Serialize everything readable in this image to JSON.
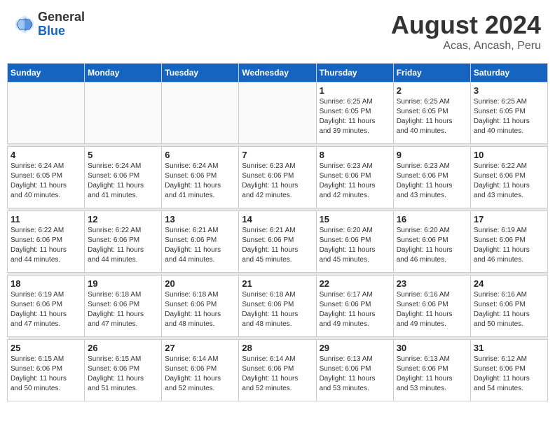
{
  "header": {
    "logo_general": "General",
    "logo_blue": "Blue",
    "month_year": "August 2024",
    "location": "Acas, Ancash, Peru"
  },
  "days_of_week": [
    "Sunday",
    "Monday",
    "Tuesday",
    "Wednesday",
    "Thursday",
    "Friday",
    "Saturday"
  ],
  "weeks": [
    [
      {
        "day": "",
        "info": ""
      },
      {
        "day": "",
        "info": ""
      },
      {
        "day": "",
        "info": ""
      },
      {
        "day": "",
        "info": ""
      },
      {
        "day": "1",
        "info": "Sunrise: 6:25 AM\nSunset: 6:05 PM\nDaylight: 11 hours\nand 39 minutes."
      },
      {
        "day": "2",
        "info": "Sunrise: 6:25 AM\nSunset: 6:05 PM\nDaylight: 11 hours\nand 40 minutes."
      },
      {
        "day": "3",
        "info": "Sunrise: 6:25 AM\nSunset: 6:05 PM\nDaylight: 11 hours\nand 40 minutes."
      }
    ],
    [
      {
        "day": "4",
        "info": "Sunrise: 6:24 AM\nSunset: 6:05 PM\nDaylight: 11 hours\nand 40 minutes."
      },
      {
        "day": "5",
        "info": "Sunrise: 6:24 AM\nSunset: 6:06 PM\nDaylight: 11 hours\nand 41 minutes."
      },
      {
        "day": "6",
        "info": "Sunrise: 6:24 AM\nSunset: 6:06 PM\nDaylight: 11 hours\nand 41 minutes."
      },
      {
        "day": "7",
        "info": "Sunrise: 6:23 AM\nSunset: 6:06 PM\nDaylight: 11 hours\nand 42 minutes."
      },
      {
        "day": "8",
        "info": "Sunrise: 6:23 AM\nSunset: 6:06 PM\nDaylight: 11 hours\nand 42 minutes."
      },
      {
        "day": "9",
        "info": "Sunrise: 6:23 AM\nSunset: 6:06 PM\nDaylight: 11 hours\nand 43 minutes."
      },
      {
        "day": "10",
        "info": "Sunrise: 6:22 AM\nSunset: 6:06 PM\nDaylight: 11 hours\nand 43 minutes."
      }
    ],
    [
      {
        "day": "11",
        "info": "Sunrise: 6:22 AM\nSunset: 6:06 PM\nDaylight: 11 hours\nand 44 minutes."
      },
      {
        "day": "12",
        "info": "Sunrise: 6:22 AM\nSunset: 6:06 PM\nDaylight: 11 hours\nand 44 minutes."
      },
      {
        "day": "13",
        "info": "Sunrise: 6:21 AM\nSunset: 6:06 PM\nDaylight: 11 hours\nand 44 minutes."
      },
      {
        "day": "14",
        "info": "Sunrise: 6:21 AM\nSunset: 6:06 PM\nDaylight: 11 hours\nand 45 minutes."
      },
      {
        "day": "15",
        "info": "Sunrise: 6:20 AM\nSunset: 6:06 PM\nDaylight: 11 hours\nand 45 minutes."
      },
      {
        "day": "16",
        "info": "Sunrise: 6:20 AM\nSunset: 6:06 PM\nDaylight: 11 hours\nand 46 minutes."
      },
      {
        "day": "17",
        "info": "Sunrise: 6:19 AM\nSunset: 6:06 PM\nDaylight: 11 hours\nand 46 minutes."
      }
    ],
    [
      {
        "day": "18",
        "info": "Sunrise: 6:19 AM\nSunset: 6:06 PM\nDaylight: 11 hours\nand 47 minutes."
      },
      {
        "day": "19",
        "info": "Sunrise: 6:18 AM\nSunset: 6:06 PM\nDaylight: 11 hours\nand 47 minutes."
      },
      {
        "day": "20",
        "info": "Sunrise: 6:18 AM\nSunset: 6:06 PM\nDaylight: 11 hours\nand 48 minutes."
      },
      {
        "day": "21",
        "info": "Sunrise: 6:18 AM\nSunset: 6:06 PM\nDaylight: 11 hours\nand 48 minutes."
      },
      {
        "day": "22",
        "info": "Sunrise: 6:17 AM\nSunset: 6:06 PM\nDaylight: 11 hours\nand 49 minutes."
      },
      {
        "day": "23",
        "info": "Sunrise: 6:16 AM\nSunset: 6:06 PM\nDaylight: 11 hours\nand 49 minutes."
      },
      {
        "day": "24",
        "info": "Sunrise: 6:16 AM\nSunset: 6:06 PM\nDaylight: 11 hours\nand 50 minutes."
      }
    ],
    [
      {
        "day": "25",
        "info": "Sunrise: 6:15 AM\nSunset: 6:06 PM\nDaylight: 11 hours\nand 50 minutes."
      },
      {
        "day": "26",
        "info": "Sunrise: 6:15 AM\nSunset: 6:06 PM\nDaylight: 11 hours\nand 51 minutes."
      },
      {
        "day": "27",
        "info": "Sunrise: 6:14 AM\nSunset: 6:06 PM\nDaylight: 11 hours\nand 52 minutes."
      },
      {
        "day": "28",
        "info": "Sunrise: 6:14 AM\nSunset: 6:06 PM\nDaylight: 11 hours\nand 52 minutes."
      },
      {
        "day": "29",
        "info": "Sunrise: 6:13 AM\nSunset: 6:06 PM\nDaylight: 11 hours\nand 53 minutes."
      },
      {
        "day": "30",
        "info": "Sunrise: 6:13 AM\nSunset: 6:06 PM\nDaylight: 11 hours\nand 53 minutes."
      },
      {
        "day": "31",
        "info": "Sunrise: 6:12 AM\nSunset: 6:06 PM\nDaylight: 11 hours\nand 54 minutes."
      }
    ]
  ]
}
